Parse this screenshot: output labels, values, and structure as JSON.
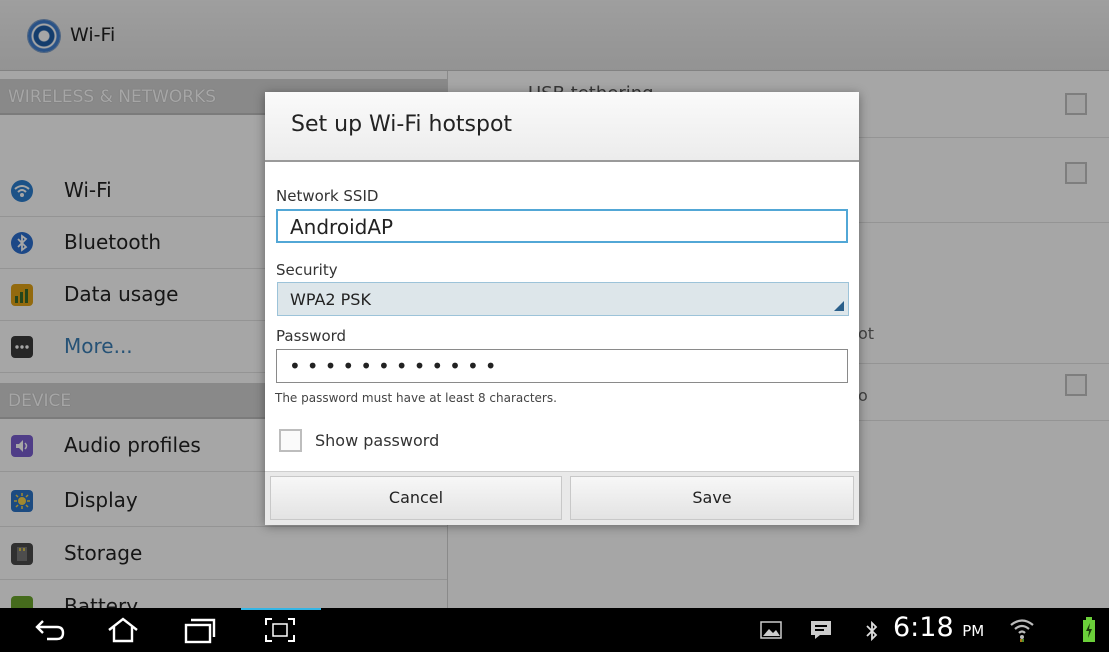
{
  "actionbar": {
    "title": "Wi-Fi",
    "icon": "settings-app-icon"
  },
  "left_pane": {
    "sections": [
      {
        "header": "WIRELESS & NETWORKS"
      },
      {
        "header": "DEVICE"
      }
    ],
    "items": [
      {
        "label": "Wi-Fi",
        "icon": "wifi-icon",
        "color": "#2b7fcf"
      },
      {
        "label": "Bluetooth",
        "icon": "bluetooth-icon",
        "color": "#2b6fcf"
      },
      {
        "label": "Data usage",
        "icon": "data-usage-icon",
        "color": "#e2a316"
      },
      {
        "label": "More...",
        "icon": "more-icon",
        "color": "#3b3b3b"
      },
      {
        "label": "Audio profiles",
        "icon": "audio-profiles-icon",
        "color": "#7a5ecf"
      },
      {
        "label": "Display",
        "icon": "display-icon",
        "color": "#2c74c7"
      },
      {
        "label": "Storage",
        "icon": "storage-icon",
        "color": "#4a4a4a"
      },
      {
        "label": "Battery",
        "icon": "battery-icon",
        "color": "#6aa52c"
      }
    ]
  },
  "right_pane": {
    "partial_rows": [
      {
        "text": "USB tethering"
      },
      {
        "text": "ot"
      },
      {
        "text": "o"
      }
    ]
  },
  "dialog": {
    "title": "Set up Wi-Fi hotspot",
    "ssid_label": "Network SSID",
    "ssid_value": "AndroidAP",
    "security_label": "Security",
    "security_value": "WPA2 PSK",
    "password_label": "Password",
    "password_value": "••••••••••••",
    "password_hint": "The password must have at least 8 characters.",
    "show_password_label": "Show password",
    "show_password_checked": false,
    "cancel_label": "Cancel",
    "save_label": "Save"
  },
  "status_bar": {
    "time": "6:18",
    "ampm": "PM",
    "accent_color": "#33b5e5"
  }
}
